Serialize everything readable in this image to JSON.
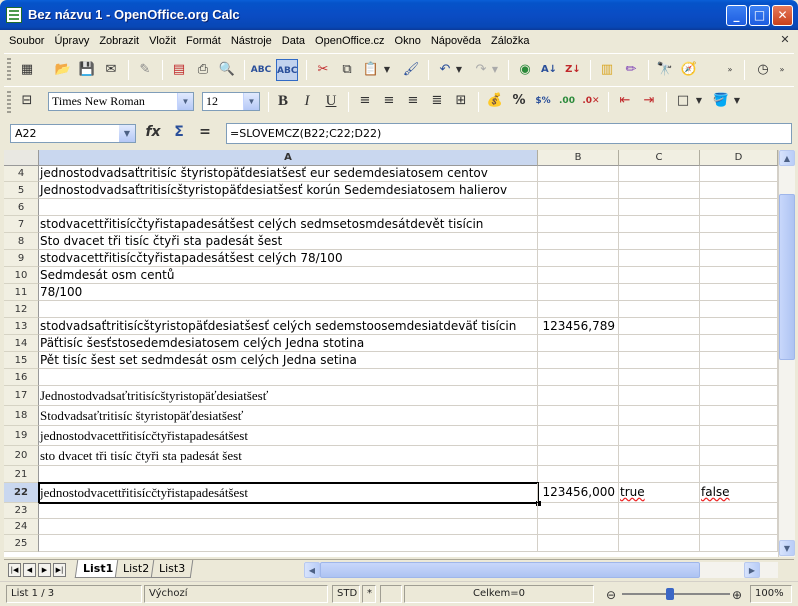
{
  "window": {
    "title": "Bez názvu 1 - OpenOffice.org Calc"
  },
  "menu": [
    "Soubor",
    "Úpravy",
    "Zobrazit",
    "Vložit",
    "Formát",
    "Nástroje",
    "Data",
    "OpenOffice.cz",
    "Okno",
    "Nápověda",
    "Záložka"
  ],
  "formatting": {
    "font_name": "Times New Roman",
    "font_size": "12"
  },
  "formula_bar": {
    "cell_ref": "A22",
    "formula": "=SLOVEMCZ(B22;C22;D22)"
  },
  "columns": [
    "A",
    "B",
    "C",
    "D"
  ],
  "rows": [
    {
      "num": "4",
      "a": "jednostodvadsaťtritisíc štyristopäťdesiatšesť eur sedemdesiatosem centov",
      "b": "",
      "c": "",
      "d": ""
    },
    {
      "num": "5",
      "a": "Jednostodvadsaťtritisícštyristopäťdesiatšesť korún Sedemdesiatosem halierov",
      "b": "",
      "c": "",
      "d": ""
    },
    {
      "num": "6",
      "a": "",
      "b": "",
      "c": "",
      "d": ""
    },
    {
      "num": "7",
      "a": "stodvacettřitisícčtyřistapadesátšest celých sedmsetosmdesátdevět tisícin",
      "b": "",
      "c": "",
      "d": ""
    },
    {
      "num": "8",
      "a": "Sto dvacet tři tisíc čtyři sta padesát šest",
      "b": "",
      "c": "",
      "d": ""
    },
    {
      "num": "9",
      "a": "stodvacettřitisícčtyřistapadesátšest celých 78/100",
      "b": "",
      "c": "",
      "d": ""
    },
    {
      "num": "10",
      "a": "Sedmdesát osm centů",
      "b": "",
      "c": "",
      "d": ""
    },
    {
      "num": "11",
      "a": "78/100",
      "b": "",
      "c": "",
      "d": ""
    },
    {
      "num": "12",
      "a": "",
      "b": "",
      "c": "",
      "d": ""
    },
    {
      "num": "13",
      "a": "stodvadsaťtritisícštyristopäťdesiatšesť celých sedemstoosemdesiatdeväť tisícin",
      "b": "123456,789",
      "c": "",
      "d": ""
    },
    {
      "num": "14",
      "a": "Päťtisíc šesťstosedemdesiatosem celých Jedna stotina",
      "b": "",
      "c": "",
      "d": ""
    },
    {
      "num": "15",
      "a": "Pět tisíc šest set sedmdesát osm celých Jedna setina",
      "b": "",
      "c": "",
      "d": ""
    },
    {
      "num": "16",
      "a": "",
      "b": "",
      "c": "",
      "d": ""
    },
    {
      "num": "17",
      "a": "Jednostodvadsaťtritisícštyristopäťdesiatšesť",
      "b": "",
      "c": "",
      "d": ""
    },
    {
      "num": "18",
      "a": "Stodvadsaťtritisíc štyristopäťdesiatšesť",
      "b": "",
      "c": "",
      "d": ""
    },
    {
      "num": "19",
      "a": "jednostodvacettřitisícčtyřistapadesátšest",
      "b": "",
      "c": "",
      "d": ""
    },
    {
      "num": "20",
      "a": "sto dvacet tři tisíc čtyři sta padesát šest",
      "b": "",
      "c": "",
      "d": ""
    },
    {
      "num": "21",
      "a": "",
      "b": "",
      "c": "",
      "d": ""
    },
    {
      "num": "22",
      "a": "jednostodvacettřitisícčtyřistapadesátšest",
      "b": "123456,000",
      "c": "true",
      "d": "false"
    },
    {
      "num": "23",
      "a": "",
      "b": "",
      "c": "",
      "d": ""
    },
    {
      "num": "24",
      "a": "",
      "b": "",
      "c": "",
      "d": ""
    },
    {
      "num": "25",
      "a": "",
      "b": "",
      "c": "",
      "d": ""
    }
  ],
  "sheets": [
    "List1",
    "List2",
    "List3"
  ],
  "status": {
    "sheet": "List 1 / 3",
    "style": "Výchozí",
    "mode": "STD",
    "modified": "*",
    "sum": "Celkem=0",
    "zoom": "100%"
  }
}
